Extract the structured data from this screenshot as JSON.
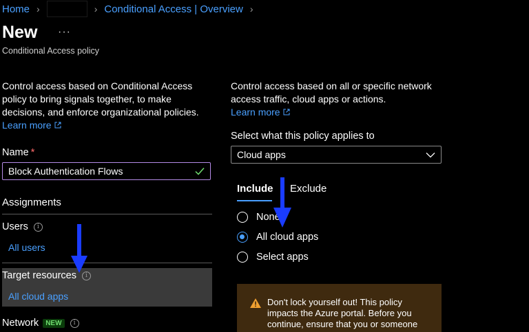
{
  "breadcrumb": {
    "home": "Home",
    "current": "Conditional Access | Overview"
  },
  "page": {
    "title": "New",
    "more": "···",
    "subtitle": "Conditional Access policy"
  },
  "left": {
    "description": "Control access based on Conditional Access policy to bring signals together, to make decisions, and enforce organizational policies.",
    "learn_more": "Learn more",
    "name_label": "Name",
    "required_mark": "*",
    "name_value": "Block Authentication Flows",
    "assignments": "Assignments",
    "users_label": "Users",
    "users_value": "All users",
    "target_label": "Target resources",
    "target_value": "All cloud apps",
    "network_label": "Network",
    "network_badge": "NEW"
  },
  "right": {
    "description": "Control access based on all or specific network access traffic, cloud apps or actions.",
    "learn_more": "Learn more",
    "select_label": "Select what this policy applies to",
    "select_value": "Cloud apps",
    "tabs": {
      "include": "Include",
      "exclude": "Exclude"
    },
    "options": [
      {
        "label": "None",
        "checked": false
      },
      {
        "label": "All cloud apps",
        "checked": true
      },
      {
        "label": "Select apps",
        "checked": false
      }
    ],
    "warning": "Don't lock yourself out! This policy impacts the Azure portal. Before you continue, ensure that you or someone"
  },
  "colors": {
    "link": "#4aa0ff",
    "background": "#000000",
    "selected_panel": "#3a3a3a",
    "input_focus_border": "#b58be8",
    "warning_bg": "#3f2a0f",
    "annotation_arrow": "#1a3cff"
  },
  "icons": {
    "breadcrumb_separator": "chevron-right-icon",
    "external_link": "external-link-icon",
    "valid": "checkmark-icon",
    "info": "info-icon",
    "dropdown": "chevron-down-icon",
    "warning": "warning-triangle-icon"
  }
}
